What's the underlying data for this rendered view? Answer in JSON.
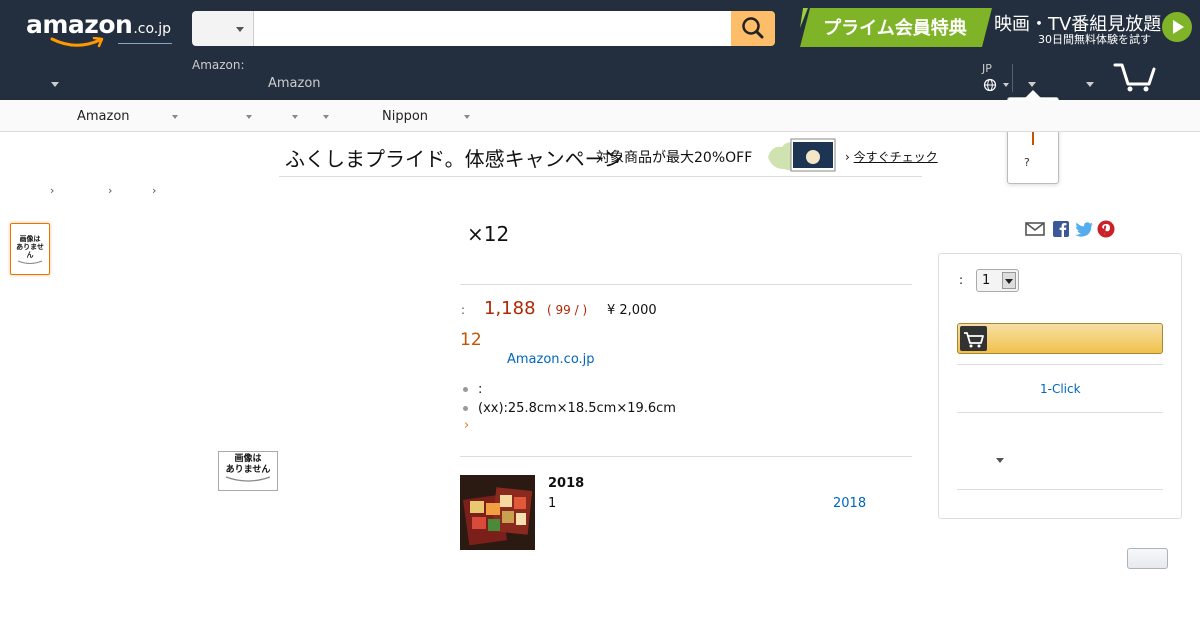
{
  "header": {
    "logo_text": "amazon",
    "logo_tld": ".co.jp",
    "search_placeholder": "",
    "prime_banner": "プライム会員特典",
    "video_banner": "映画・TV番組見放題",
    "trial_text": "30日間無料体験を試す",
    "address_label": "Amazon:",
    "address_link": "Amazon",
    "language": "JP"
  },
  "popover": {
    "hint": "?"
  },
  "category_bar": {
    "items": [
      "Amazon",
      "Nippon"
    ]
  },
  "promo": {
    "title": "ふくしまプライド。体感キャンペーン",
    "discount": "対象商品が最大20%OFF",
    "cta": "今すぐチェック"
  },
  "breadcrumb": {
    "separator": "›"
  },
  "thumbnail": {
    "no_image_line1": "画像は",
    "no_image_line2": "ありません"
  },
  "product": {
    "title": "×12",
    "price_label": ":",
    "price": "1,188",
    "unit_price": "( 99 /  )",
    "list_price": "¥ 2,000",
    "stock": "12",
    "seller": "Amazon.co.jp",
    "bullets": [
      ":",
      "(xx):25.8cm×18.5cm×19.6cm"
    ],
    "more": "›"
  },
  "related": {
    "title": "2018",
    "qty": "1",
    "link": "2018"
  },
  "buybox": {
    "qty_label": ":",
    "qty_value": "1",
    "one_click": "1-Click"
  },
  "colors": {
    "header_bg": "#232f3e",
    "search_btn": "#febd69",
    "price": "#b12704",
    "stock": "#c45500",
    "link": "#0066c0",
    "prime_green": "#7fb428"
  }
}
